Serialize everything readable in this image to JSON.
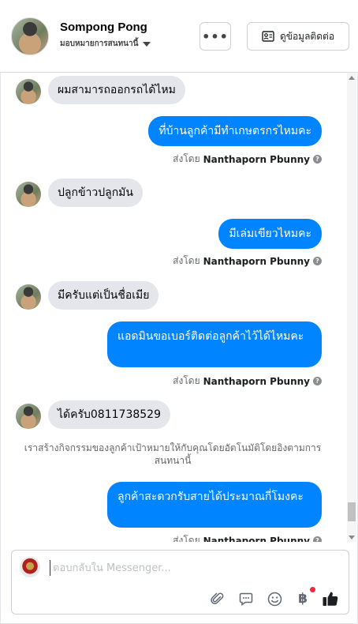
{
  "header": {
    "name": "Sompong Pong",
    "subtitle": "มอบหมายการสนทนานี้",
    "info_button": "ดูข้อมูลติดต่อ"
  },
  "messages": [
    {
      "dir": "in",
      "text": "ผมสามารถออกรถได้ไหม"
    },
    {
      "dir": "out",
      "text": "ที่บ้านลูกค้ามีทำเกษตรกรไหมคะ",
      "sent_prefix": "ส่งโดย",
      "sent_by": "Nanthaporn Pbunny"
    },
    {
      "dir": "in",
      "text": "ปลูกข้าวปลูกมัน"
    },
    {
      "dir": "out",
      "text": "มีเล่มเขียวไหมคะ",
      "sent_prefix": "ส่งโดย",
      "sent_by": "Nanthaporn Pbunny"
    },
    {
      "dir": "in",
      "text": "มีครับแต่เป็นชื่อเมีย"
    },
    {
      "dir": "out",
      "text": "แอดมินขอเบอร์ติดต่อลูกค้าไว้ได้ไหมคะ",
      "sent_prefix": "ส่งโดย",
      "sent_by": "Nanthaporn Pbunny"
    },
    {
      "dir": "in",
      "text": "ได้ครับ0811738529"
    },
    {
      "dir": "out",
      "text": "ลูกค้าสะดวกรับสายได้ประมาณกี่โมงคะ",
      "sent_prefix": "ส่งโดย",
      "sent_by": "Nanthaporn Pbunny"
    }
  ],
  "notice": "เราสร้างกิจกรรมของลูกค้าเป้าหมายให้กับคุณโดยอัตโนมัติโดยอิงตามการสนทนานี้",
  "composer": {
    "placeholder": "ตอบกลับใน Messenger..."
  },
  "icons": [
    "more-icon",
    "contact-card-icon",
    "help-icon",
    "attachment-icon",
    "saved-reply-icon",
    "emoji-icon",
    "baht-payment-icon",
    "like-thumb-icon"
  ],
  "colors": {
    "accent": "#0084ff",
    "incoming_bubble": "#e4e6eb",
    "badge": "#f02849"
  }
}
